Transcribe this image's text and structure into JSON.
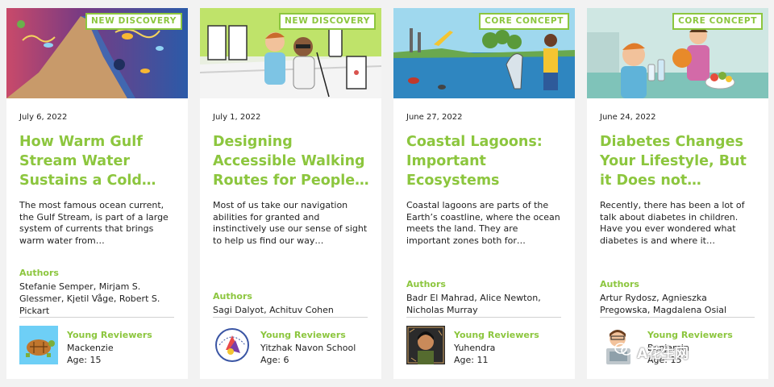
{
  "cards": [
    {
      "badge": "NEW DISCOVERY",
      "date": "July 6, 2022",
      "title": "How Warm Gulf Stream Water Sustains a Cold…",
      "summary": "The most famous ocean current, the Gulf Stream, is part of a large system of currents that brings warm water from…",
      "authors_label": "Authors",
      "authors": "Stefanie Semper, Mirjam S. Glessmer, Kjetil Våge, Robert S. Pickart",
      "reviewers_label": "Young Reviewers",
      "reviewer_name": "Mackenzie",
      "reviewer_age": "Age: 15",
      "image_icon": "ocean-current-illustration",
      "avatar_icon": "sea-turtle-drawing"
    },
    {
      "badge": "NEW DISCOVERY",
      "date": "July 1, 2022",
      "title": "Designing Accessible Walking Routes for People…",
      "summary": "Most of us take our navigation abilities for granted and instinctively use our sense of sight to help us find our way…",
      "authors_label": "Authors",
      "authors": "Sagi Dalyot, Achituv Cohen",
      "reviewers_label": "Young Reviewers",
      "reviewer_name": "Yitzhak Navon School",
      "reviewer_age": "Age: 6",
      "image_icon": "walking-route-illustration",
      "avatar_icon": "school-logo"
    },
    {
      "badge": "CORE CONCEPT",
      "date": "June 27, 2022",
      "title": "Coastal Lagoons: Important Ecosystems",
      "summary": "Coastal lagoons are parts of the Earth’s coastline, where the ocean meets the land. They are important zones both for…",
      "authors_label": "Authors",
      "authors": "Badr El Mahrad, Alice Newton, Nicholas Murray",
      "reviewers_label": "Young Reviewers",
      "reviewer_name": "Yuhendra",
      "reviewer_age": "Age: 11",
      "image_icon": "coastal-lagoon-illustration",
      "avatar_icon": "reviewer-portrait"
    },
    {
      "badge": "CORE CONCEPT",
      "date": "June 24, 2022",
      "title": "Diabetes Changes Your Lifestyle, But it Does not…",
      "summary": "Recently, there has been a lot of talk about diabetes in children. Have you ever wondered what diabetes is and where it…",
      "authors_label": "Authors",
      "authors": "Artur Rydosz, Agnieszka Pregowska, Magdalena Osial",
      "reviewers_label": "Young Reviewers",
      "reviewer_name": "Benjamin",
      "reviewer_age": "Age: 15",
      "image_icon": "kitchen-kids-illustration",
      "avatar_icon": "boy-with-laptop-drawing"
    }
  ],
  "watermark": "A花生网",
  "colors": {
    "accent": "#8cc63e",
    "text": "#222222",
    "background": "#f2f2f2",
    "divider": "#d2d2d2"
  }
}
